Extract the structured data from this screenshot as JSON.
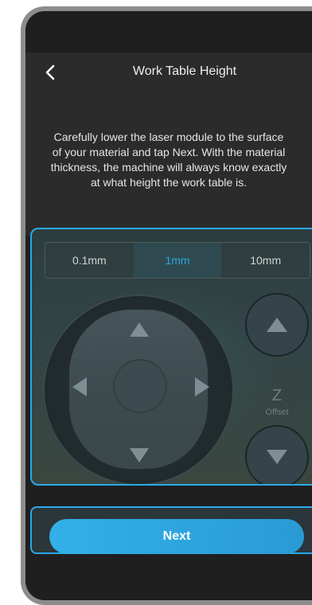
{
  "header": {
    "title": "Work Table Height",
    "back_icon": "chevron-left-icon"
  },
  "instructions": {
    "text": "Carefully lower the laser module to the surface of your material and tap Next. With the material thickness, the machine will always know exactly at what height the work table is."
  },
  "step_selector": {
    "options": [
      "0.1mm",
      "1mm",
      "10mm"
    ],
    "selected": "1mm"
  },
  "z_control": {
    "label": "Z",
    "sublabel": "Offset"
  },
  "footer": {
    "next_label": "Next"
  },
  "colors": {
    "accent": "#2aa8e8",
    "selected_text": "#2ea3dc",
    "background": "#1f1f1f",
    "header_bg": "#2b2b2b"
  }
}
